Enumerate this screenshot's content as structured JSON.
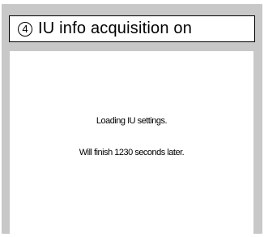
{
  "title": {
    "step_number": "4",
    "text": "IU info acquisition on"
  },
  "status": {
    "loading": "Loading IU settings.",
    "finish": "Will finish 1230 seconds later."
  }
}
